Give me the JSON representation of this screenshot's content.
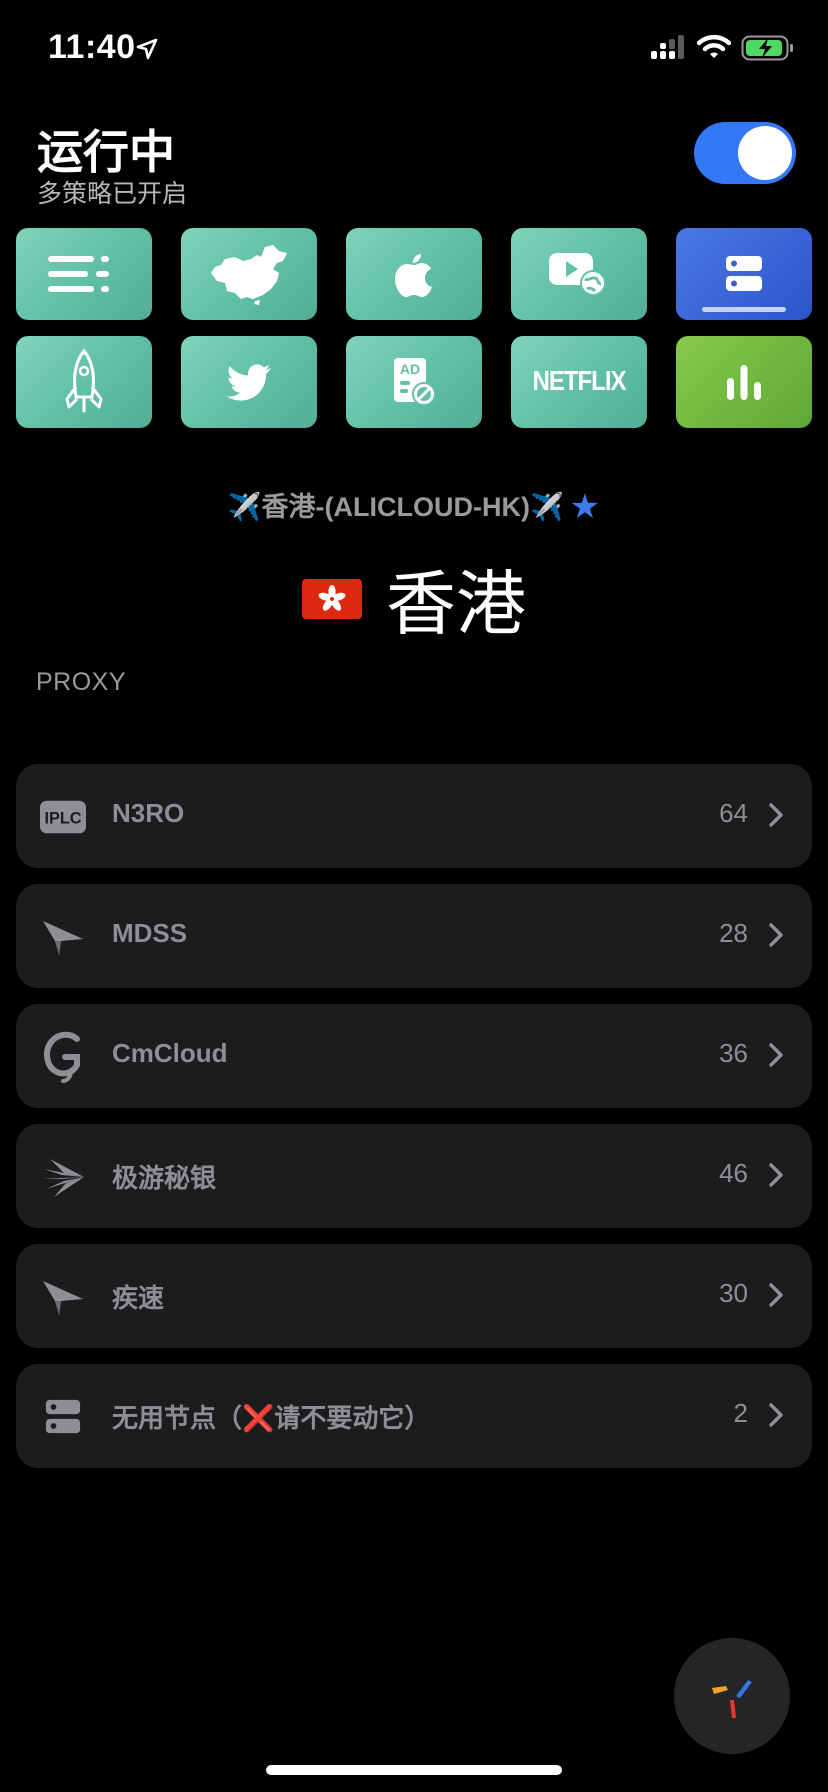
{
  "status_bar": {
    "time": "11:40"
  },
  "header": {
    "title": "运行中",
    "subtitle": "多策略已开启",
    "toggle_on": true
  },
  "policy_tiles": [
    {
      "icon": "list-icon"
    },
    {
      "icon": "china-map-icon"
    },
    {
      "icon": "apple-icon"
    },
    {
      "icon": "video-globe-icon"
    },
    {
      "icon": "server-icon",
      "active": true
    },
    {
      "icon": "rocket-icon"
    },
    {
      "icon": "twitter-icon"
    },
    {
      "icon": "ad-block-icon",
      "label": "AD"
    },
    {
      "icon": "netflix-icon",
      "label": "NETFLIX"
    },
    {
      "icon": "bar-chart-icon"
    }
  ],
  "current_proxy": {
    "name": "✈️香港-(ALICLOUD-HK)✈️",
    "starred": true,
    "star_color": "#3e7bf0",
    "region_flag": "🇭🇰",
    "region_name": "香港"
  },
  "section_label": "PROXY",
  "groups": [
    {
      "icon": "iplc-icon",
      "icon_text": "IPLC",
      "label": "N3RO",
      "count": "64"
    },
    {
      "icon": "paper-plane-icon",
      "label": "MDSS",
      "count": "28"
    },
    {
      "icon": "cmcloud-g-icon",
      "label": "CmCloud",
      "count": "36"
    },
    {
      "icon": "burst-icon",
      "label": "极游秘银",
      "count": "46"
    },
    {
      "icon": "paper-plane-icon",
      "label": "疾速",
      "count": "30"
    },
    {
      "icon": "server-icon",
      "label": "无用节点（❌请不要动它）",
      "count": "2"
    }
  ],
  "colors": {
    "accent": "#3478f6",
    "tile": "#6cc6ad",
    "active_tile": "#3b64d6",
    "chart_tile": "#72b93f"
  }
}
